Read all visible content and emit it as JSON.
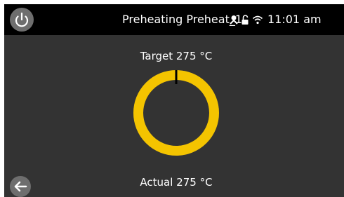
{
  "status_bar": {
    "mode": "Preheating",
    "preset": "Preheat_1",
    "time": "11:01 am",
    "icons": [
      "user-icon",
      "lock-icon",
      "wifi-icon"
    ]
  },
  "temperature": {
    "target_label": "Target 275 °C",
    "actual_label": "Actual 275 °C",
    "progress_fraction": 1.0
  },
  "colors": {
    "ring": "#f4c400",
    "background": "#333333",
    "header": "#000000"
  },
  "buttons": {
    "power_icon": "power-icon",
    "back_icon": "back-arrow-icon"
  }
}
